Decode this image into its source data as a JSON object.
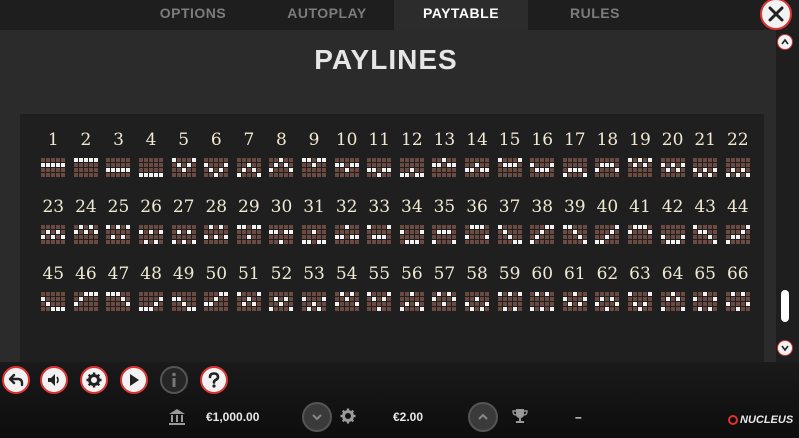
{
  "tabs": [
    {
      "label": "OPTIONS",
      "active": false
    },
    {
      "label": "AUTOPLAY",
      "active": false
    },
    {
      "label": "PAYTABLE",
      "active": true
    },
    {
      "label": "RULES",
      "active": false
    }
  ],
  "title": "PAYLINES",
  "paylines": [
    {
      "n": "1",
      "rows": [
        1,
        1,
        1,
        1,
        1
      ]
    },
    {
      "n": "2",
      "rows": [
        0,
        0,
        0,
        0,
        0
      ]
    },
    {
      "n": "3",
      "rows": [
        2,
        2,
        2,
        2,
        2
      ]
    },
    {
      "n": "4",
      "rows": [
        3,
        3,
        3,
        3,
        3
      ]
    },
    {
      "n": "5",
      "rows": [
        0,
        1,
        2,
        1,
        0
      ]
    },
    {
      "n": "6",
      "rows": [
        1,
        2,
        3,
        2,
        1
      ]
    },
    {
      "n": "7",
      "rows": [
        3,
        2,
        1,
        2,
        3
      ]
    },
    {
      "n": "8",
      "rows": [
        2,
        1,
        0,
        1,
        2
      ]
    },
    {
      "n": "9",
      "rows": [
        0,
        0,
        1,
        0,
        0
      ]
    },
    {
      "n": "10",
      "rows": [
        1,
        1,
        2,
        1,
        1
      ]
    },
    {
      "n": "11",
      "rows": [
        2,
        2,
        3,
        2,
        2
      ]
    },
    {
      "n": "12",
      "rows": [
        3,
        3,
        2,
        3,
        3
      ]
    },
    {
      "n": "13",
      "rows": [
        1,
        1,
        0,
        1,
        1
      ]
    },
    {
      "n": "14",
      "rows": [
        2,
        2,
        1,
        2,
        2
      ]
    },
    {
      "n": "15",
      "rows": [
        0,
        1,
        1,
        1,
        0
      ]
    },
    {
      "n": "16",
      "rows": [
        1,
        2,
        2,
        2,
        1
      ]
    },
    {
      "n": "17",
      "rows": [
        3,
        2,
        2,
        2,
        3
      ]
    },
    {
      "n": "18",
      "rows": [
        2,
        1,
        1,
        1,
        2
      ]
    },
    {
      "n": "19",
      "rows": [
        0,
        1,
        0,
        1,
        0
      ]
    },
    {
      "n": "20",
      "rows": [
        1,
        2,
        1,
        2,
        1
      ]
    },
    {
      "n": "21",
      "rows": [
        2,
        3,
        2,
        3,
        2
      ]
    },
    {
      "n": "22",
      "rows": [
        3,
        2,
        3,
        2,
        3
      ]
    },
    {
      "n": "23",
      "rows": [
        2,
        1,
        2,
        1,
        2
      ]
    },
    {
      "n": "24",
      "rows": [
        1,
        0,
        1,
        0,
        1
      ]
    },
    {
      "n": "25",
      "rows": [
        0,
        2,
        0,
        2,
        0
      ]
    },
    {
      "n": "26",
      "rows": [
        1,
        3,
        1,
        3,
        1
      ]
    },
    {
      "n": "27",
      "rows": [
        3,
        1,
        3,
        1,
        3
      ]
    },
    {
      "n": "28",
      "rows": [
        2,
        0,
        2,
        0,
        2
      ]
    },
    {
      "n": "29",
      "rows": [
        0,
        0,
        2,
        0,
        0
      ]
    },
    {
      "n": "30",
      "rows": [
        1,
        1,
        3,
        1,
        1
      ]
    },
    {
      "n": "31",
      "rows": [
        3,
        3,
        1,
        3,
        3
      ]
    },
    {
      "n": "32",
      "rows": [
        2,
        2,
        0,
        2,
        2
      ]
    },
    {
      "n": "33",
      "rows": [
        0,
        2,
        2,
        2,
        0
      ]
    },
    {
      "n": "34",
      "rows": [
        1,
        3,
        3,
        3,
        1
      ]
    },
    {
      "n": "35",
      "rows": [
        3,
        1,
        1,
        1,
        3
      ]
    },
    {
      "n": "36",
      "rows": [
        2,
        0,
        0,
        0,
        2
      ]
    },
    {
      "n": "37",
      "rows": [
        0,
        1,
        2,
        3,
        3
      ]
    },
    {
      "n": "38",
      "rows": [
        3,
        2,
        1,
        0,
        0
      ]
    },
    {
      "n": "39",
      "rows": [
        0,
        0,
        1,
        2,
        3
      ]
    },
    {
      "n": "40",
      "rows": [
        3,
        3,
        2,
        1,
        0
      ]
    },
    {
      "n": "41",
      "rows": [
        1,
        0,
        0,
        0,
        1
      ]
    },
    {
      "n": "42",
      "rows": [
        2,
        3,
        3,
        3,
        2
      ]
    },
    {
      "n": "43",
      "rows": [
        0,
        1,
        1,
        2,
        3
      ]
    },
    {
      "n": "44",
      "rows": [
        3,
        2,
        2,
        1,
        0
      ]
    },
    {
      "n": "45",
      "rows": [
        1,
        2,
        3,
        3,
        3
      ]
    },
    {
      "n": "46",
      "rows": [
        2,
        1,
        0,
        0,
        0
      ]
    },
    {
      "n": "47",
      "rows": [
        0,
        0,
        0,
        1,
        2
      ]
    },
    {
      "n": "48",
      "rows": [
        3,
        3,
        3,
        2,
        1
      ]
    },
    {
      "n": "49",
      "rows": [
        1,
        1,
        2,
        3,
        3
      ]
    },
    {
      "n": "50",
      "rows": [
        2,
        2,
        1,
        0,
        0
      ]
    },
    {
      "n": "51",
      "rows": [
        0,
        2,
        1,
        2,
        0
      ]
    },
    {
      "n": "52",
      "rows": [
        3,
        1,
        2,
        1,
        3
      ]
    },
    {
      "n": "53",
      "rows": [
        1,
        3,
        2,
        3,
        1
      ]
    },
    {
      "n": "54",
      "rows": [
        2,
        0,
        1,
        0,
        2
      ]
    },
    {
      "n": "55",
      "rows": [
        0,
        1,
        3,
        1,
        0
      ]
    },
    {
      "n": "56",
      "rows": [
        3,
        2,
        0,
        2,
        3
      ]
    },
    {
      "n": "57",
      "rows": [
        1,
        0,
        2,
        0,
        1
      ]
    },
    {
      "n": "58",
      "rows": [
        2,
        3,
        1,
        3,
        2
      ]
    },
    {
      "n": "59",
      "rows": [
        0,
        3,
        0,
        3,
        0
      ]
    },
    {
      "n": "60",
      "rows": [
        3,
        0,
        3,
        0,
        3
      ]
    },
    {
      "n": "61",
      "rows": [
        1,
        2,
        0,
        2,
        1
      ]
    },
    {
      "n": "62",
      "rows": [
        2,
        1,
        3,
        1,
        2
      ]
    },
    {
      "n": "63",
      "rows": [
        0,
        2,
        3,
        2,
        0
      ]
    },
    {
      "n": "64",
      "rows": [
        3,
        1,
        0,
        1,
        3
      ]
    },
    {
      "n": "65",
      "rows": [
        1,
        3,
        0,
        3,
        1
      ]
    },
    {
      "n": "66",
      "rows": [
        2,
        0,
        3,
        0,
        2
      ]
    }
  ],
  "icons": {
    "close": "close-icon",
    "back": "back-arrow-icon",
    "sound": "speaker-icon",
    "settings": "gear-icon",
    "autoplay": "play-icon",
    "info": "info-icon",
    "help": "question-icon"
  },
  "footer": {
    "balance": "€1,000.00",
    "bet": "€2.00",
    "win": "–",
    "brand": "NUCLEUS"
  },
  "colors": {
    "accent": "#dd3333",
    "cell_on": "#f2f2f2",
    "cell_off": "#6b4a42"
  }
}
